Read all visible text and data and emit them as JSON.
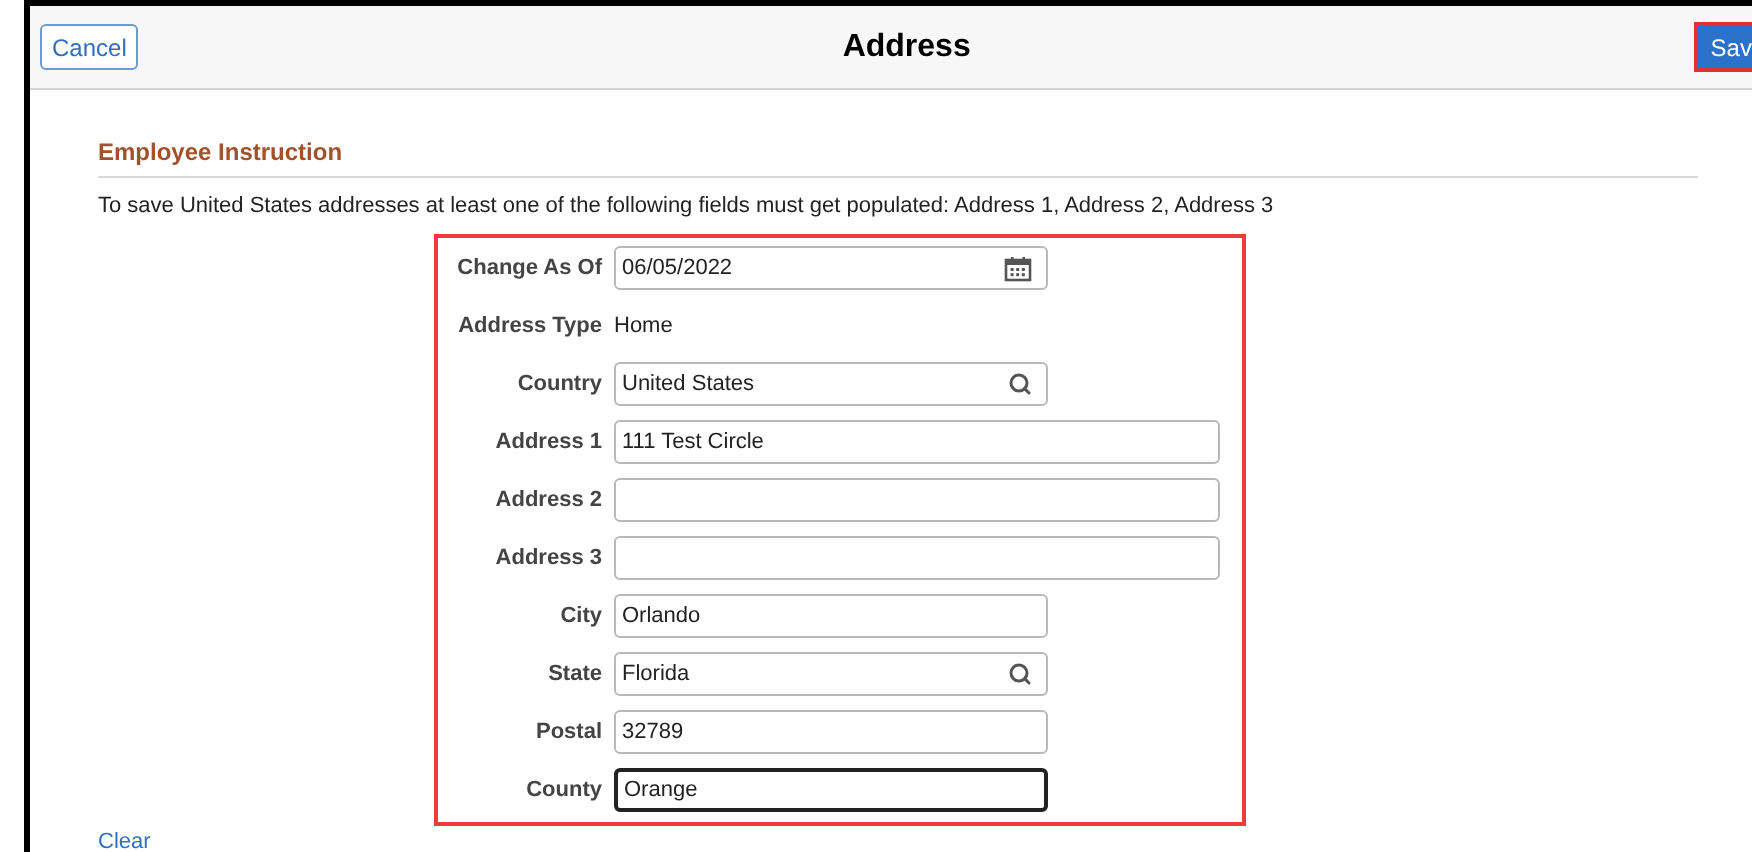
{
  "header": {
    "cancel": "Cancel",
    "title": "Address",
    "save": "Sav"
  },
  "instruction": {
    "heading": "Employee Instruction",
    "text": "To save United States addresses at least one of the following fields must get populated: Address 1, Address 2, Address 3"
  },
  "fields": [
    {
      "label": "Change As Of",
      "kind": "date",
      "value": "06/05/2022",
      "focused": false
    },
    {
      "label": "Address Type",
      "kind": "display",
      "value": "Home"
    },
    {
      "label": "Country",
      "kind": "lookup",
      "value": "United States",
      "focused": false
    },
    {
      "label": "Address 1",
      "kind": "long_text",
      "value": "111 Test Circle",
      "focused": false
    },
    {
      "label": "Address 2",
      "kind": "long_text",
      "focused": false
    },
    {
      "label": "Address 3",
      "kind": "long_text",
      "focused": false
    },
    {
      "label": "City",
      "kind": "text",
      "value": "Orlando",
      "focused": false
    },
    {
      "label": "State",
      "kind": "lookup",
      "value": "Florida",
      "focused": false
    },
    {
      "label": "Postal",
      "kind": "text",
      "value": "32789",
      "focused": false
    },
    {
      "label": "County",
      "kind": "text",
      "value": "Orange",
      "focused": true
    }
  ],
  "clear_link": "Clear"
}
